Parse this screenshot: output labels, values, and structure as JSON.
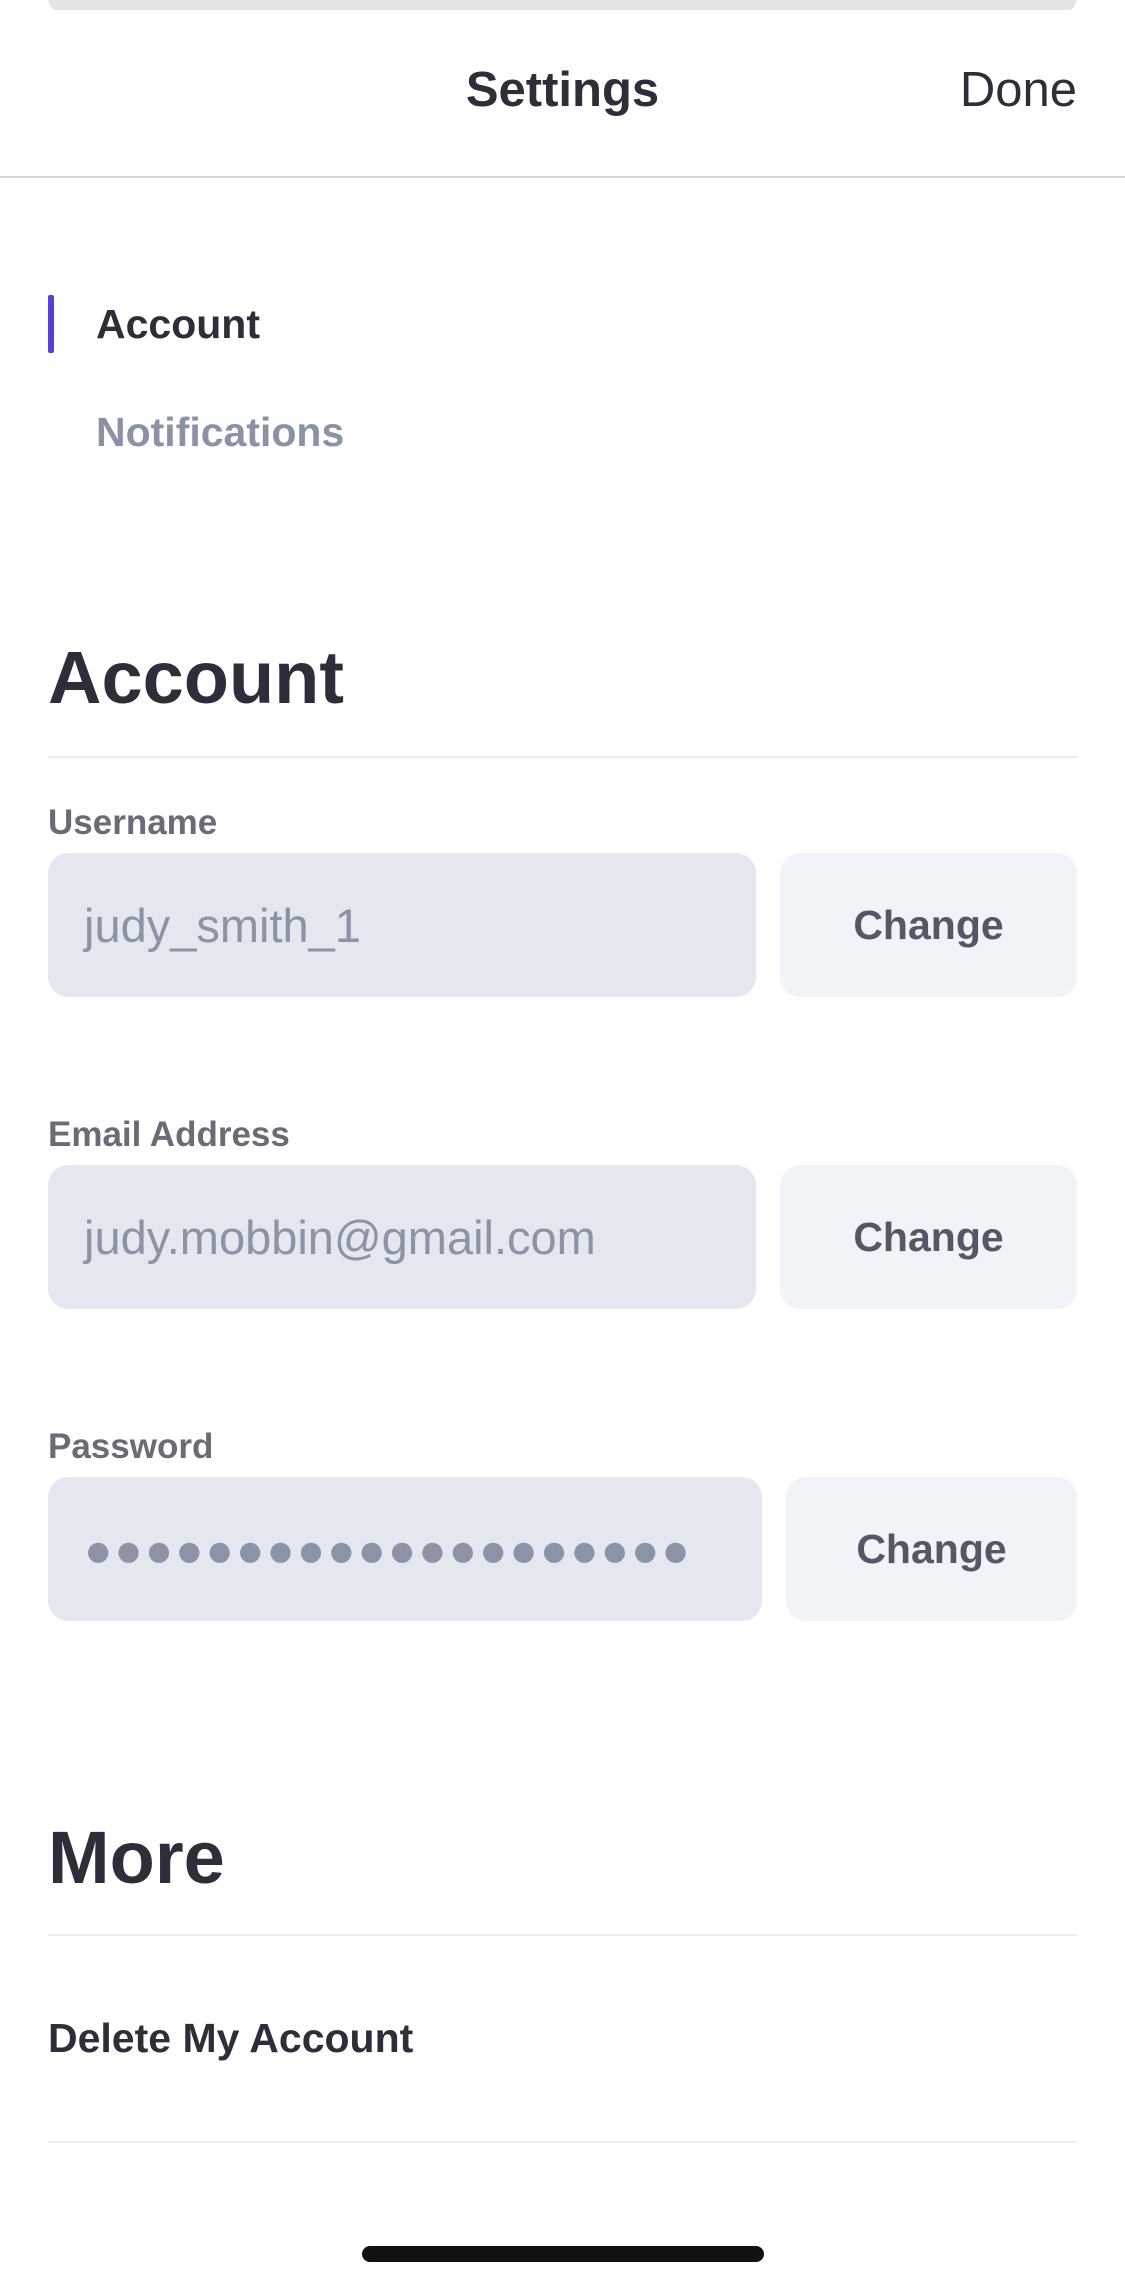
{
  "header": {
    "title": "Settings",
    "done_label": "Done"
  },
  "side_nav": {
    "items": [
      {
        "label": "Account",
        "active": true
      },
      {
        "label": "Notifications",
        "active": false
      }
    ]
  },
  "account": {
    "title": "Account",
    "fields": [
      {
        "label": "Username",
        "value": "judy_smith_1",
        "action": "Change"
      },
      {
        "label": "Email Address",
        "value": "judy.mobbin@gmail.com",
        "action": "Change"
      },
      {
        "label": "Password",
        "value": "●●●●●●●●●●●●●●●●●●●●",
        "action": "Change"
      }
    ]
  },
  "more": {
    "title": "More",
    "delete_label": "Delete My Account"
  },
  "colors": {
    "accent": "#5a3fd6",
    "text": "#2e2e3a",
    "muted": "#8a93a6",
    "input_bg": "#e4e7f0",
    "button_bg": "#f0f3f7"
  }
}
